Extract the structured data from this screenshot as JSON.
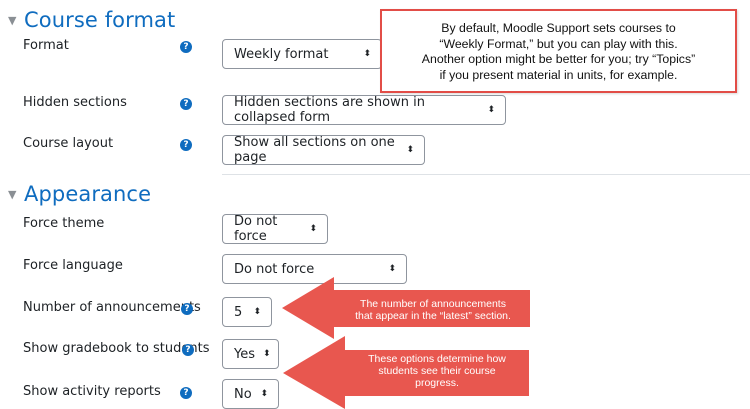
{
  "course_format": {
    "heading": "Course format",
    "fields": [
      {
        "label": "Format",
        "value": "Weekly format"
      },
      {
        "label": "Hidden sections",
        "value": "Hidden sections are shown in collapsed form"
      },
      {
        "label": "Course layout",
        "value": "Show all sections on one page"
      }
    ]
  },
  "appearance": {
    "heading": "Appearance",
    "fields": [
      {
        "label": "Force theme",
        "value": "Do not force"
      },
      {
        "label": "Force language",
        "value": "Do not force"
      },
      {
        "label": "Number of announcements",
        "value": "5"
      },
      {
        "label": "Show gradebook to students",
        "value": "Yes"
      },
      {
        "label": "Show activity reports",
        "value": "No"
      }
    ]
  },
  "annotations": {
    "format_note": [
      "By default, Moodle Support sets courses to",
      "“Weekly Format,” but you can play with this.",
      "Another option might be better for you; try “Topics”",
      "if you present material in units, for example."
    ],
    "announcements_arrow": [
      "The number of announcements",
      "that appear in the “latest” section."
    ],
    "progress_arrow": [
      "These options determine how",
      "students see their course",
      "progress."
    ]
  },
  "icons": {
    "help": "question-circle-icon",
    "collapse": "caret-down-icon",
    "select_arrow": "up-down-arrows-icon"
  },
  "colors": {
    "heading": "#0f6cbf",
    "help_icon": "#0f6cbf",
    "annotation_red": "#e8574f",
    "annotation_border": "#e24d47"
  },
  "help_glyph": "?",
  "select_glyph": "⬍"
}
